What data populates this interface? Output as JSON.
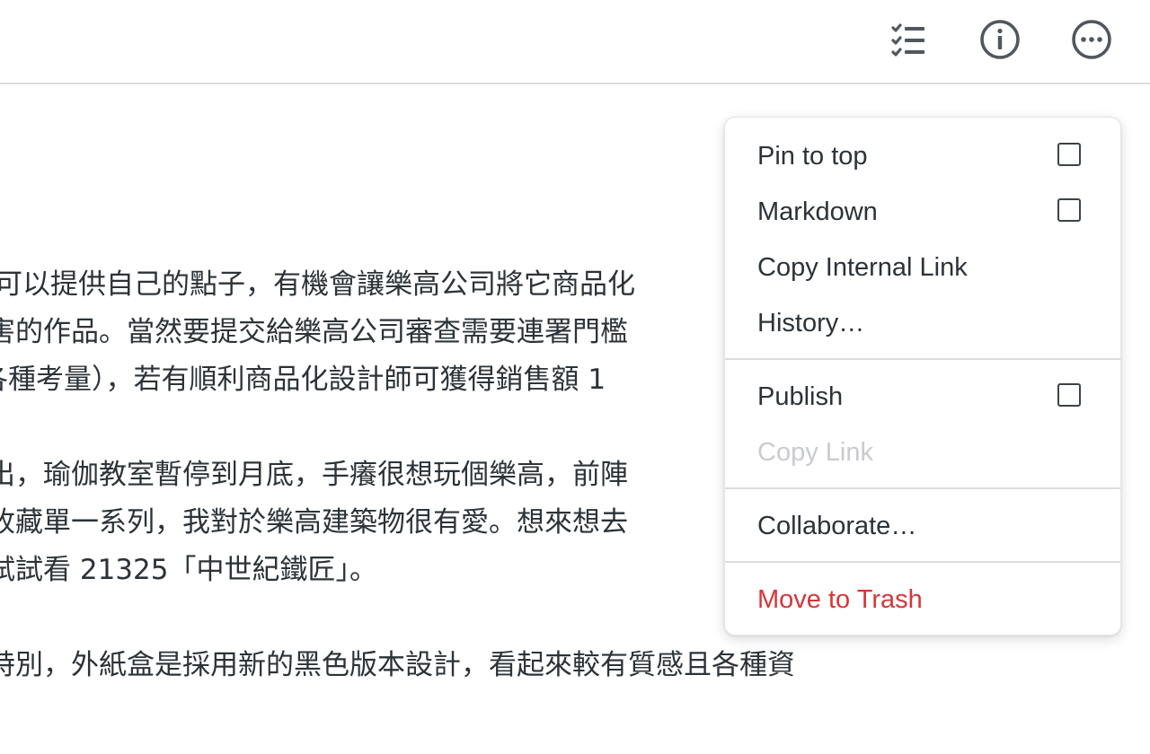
{
  "toolbar": {
    "buttons": [
      {
        "name": "checklist-icon"
      },
      {
        "name": "info-icon"
      },
      {
        "name": "more-actions-icon"
      }
    ]
  },
  "note": {
    "lines": [
      "可以提供自己的點子，有機會讓樂高公司將它商品化",
      "害的作品。當然要提交給樂高公司審查需要連署門檻",
      "各種考量），若有順利商品化設計師可獲得銷售額 1",
      "",
      "出，瑜伽教室暫停到月底，手癢很想玩個樂高，前陣",
      "收藏單一系列，我對於樂高建築物很有愛。想來想去",
      "試試看 21325「中世紀鐵匠」。",
      "",
      "特別，外紙盒是採用新的黑色版本設計，看起來較有質感且各種資"
    ]
  },
  "menu": {
    "items": {
      "pin": {
        "label": "Pin to top",
        "checked": false
      },
      "markdown": {
        "label": "Markdown",
        "checked": false
      },
      "copy_internal": {
        "label": "Copy Internal Link"
      },
      "history": {
        "label": "History…"
      },
      "publish": {
        "label": "Publish",
        "checked": false
      },
      "copy_link": {
        "label": "Copy Link",
        "disabled": true
      },
      "collaborate": {
        "label": "Collaborate…"
      },
      "trash": {
        "label": "Move to Trash"
      }
    }
  },
  "colors": {
    "text": "#2c3338",
    "disabled": "#c9cbce",
    "danger": "#d63638",
    "icon": "#50575e",
    "divider": "#dcdcde"
  }
}
